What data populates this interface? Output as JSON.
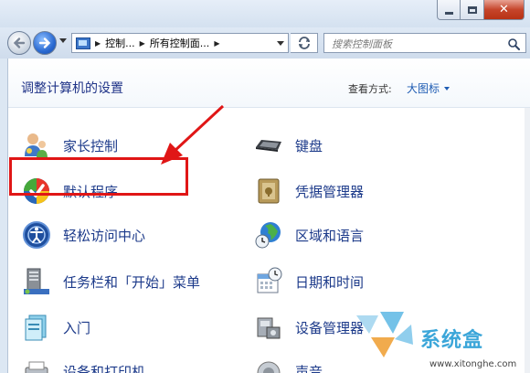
{
  "address": {
    "crumbs": [
      "控制...",
      "所有控制面..."
    ]
  },
  "search": {
    "placeholder": "搜索控制面板"
  },
  "header": {
    "title": "调整计算机的设置",
    "view_by_label": "查看方式:",
    "view_by_value": "大图标"
  },
  "items_left": [
    {
      "label": "家长控制",
      "icon": "parental-controls-icon"
    },
    {
      "label": "默认程序",
      "icon": "default-programs-icon"
    },
    {
      "label": "轻松访问中心",
      "icon": "ease-of-access-icon"
    },
    {
      "label": "任务栏和「开始」菜单",
      "icon": "taskbar-icon"
    },
    {
      "label": "入门",
      "icon": "getting-started-icon"
    },
    {
      "label": "设备和打印机",
      "icon": "devices-printers-icon"
    }
  ],
  "items_right": [
    {
      "label": "键盘",
      "icon": "keyboard-icon"
    },
    {
      "label": "凭据管理器",
      "icon": "credential-manager-icon"
    },
    {
      "label": "区域和语言",
      "icon": "region-language-icon"
    },
    {
      "label": "日期和时间",
      "icon": "date-time-icon"
    },
    {
      "label": "设备管理器",
      "icon": "device-manager-icon"
    },
    {
      "label": "声音",
      "icon": "sound-icon"
    }
  ],
  "watermark": {
    "brand": "系统盒",
    "url": "www.xitonghe.com"
  },
  "colors": {
    "link_text": "#1c3a8a",
    "highlight": "#e01616",
    "title_text": "#1e3287"
  }
}
